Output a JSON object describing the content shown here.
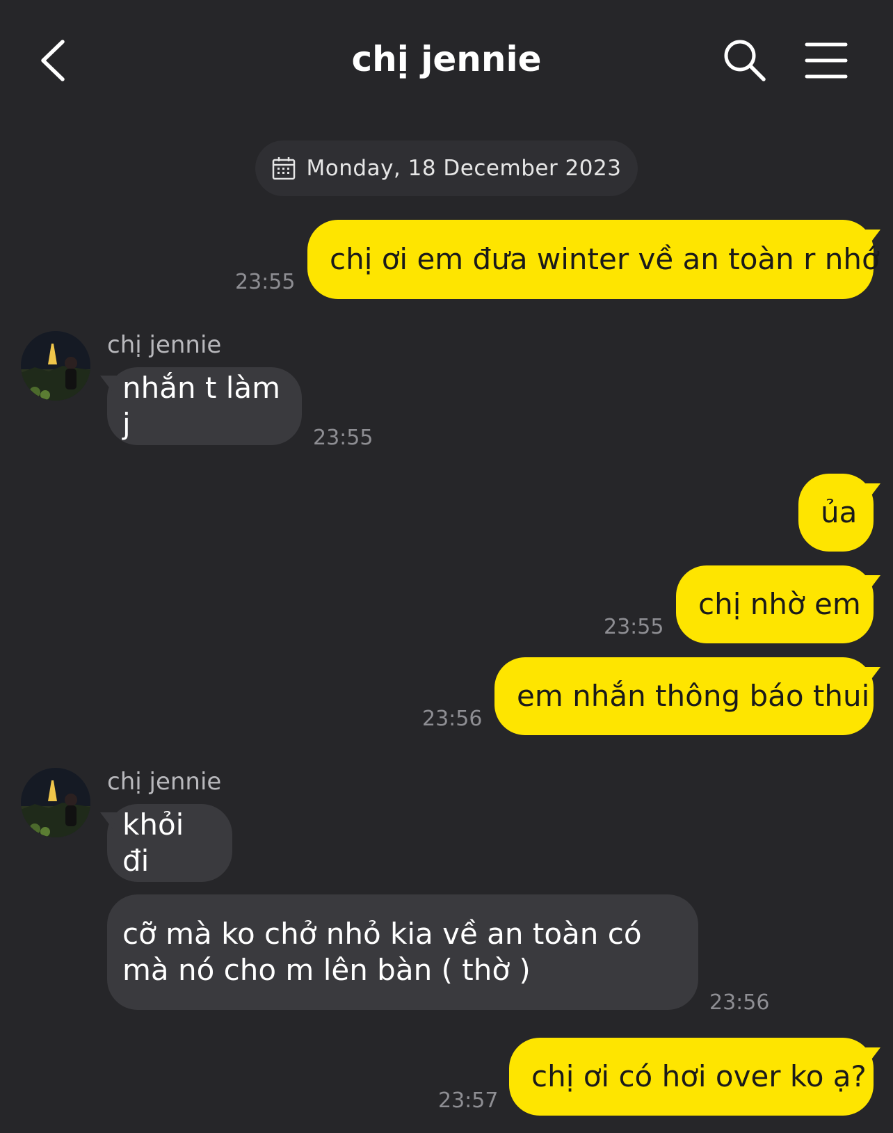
{
  "header": {
    "title": "chị jennie",
    "back_icon": "chevron-left-icon",
    "search_icon": "search-icon",
    "menu_icon": "hamburger-menu-icon"
  },
  "date_separator": {
    "icon": "calendar-icon",
    "label": "Monday, 18 December 2023"
  },
  "messages": [
    {
      "side": "out",
      "text": "chị ơi em đưa winter về an toàn r nhớ",
      "time": "23:55"
    },
    {
      "side": "in",
      "sender": "chị jennie",
      "text": "nhắn t làm j",
      "time": "23:55"
    },
    {
      "side": "out",
      "text": "ủa",
      "time": ""
    },
    {
      "side": "out",
      "text": "chị nhờ em",
      "time": "23:55"
    },
    {
      "side": "out",
      "text": "em nhắn thông báo thui",
      "time": "23:56"
    },
    {
      "side": "in",
      "sender": "chị jennie",
      "text": "khỏi đi",
      "time": ""
    },
    {
      "side": "in",
      "text": "cỡ mà ko chở nhỏ kia về an toàn có mà nó cho m lên bàn ( thờ )",
      "time": "23:56"
    },
    {
      "side": "out",
      "text": "chị ơi có hơi over ko ạ?",
      "time": "23:57"
    }
  ],
  "colors": {
    "background": "#262629",
    "outgoing_bubble": "#fee500",
    "incoming_bubble": "#3a3a3e"
  }
}
